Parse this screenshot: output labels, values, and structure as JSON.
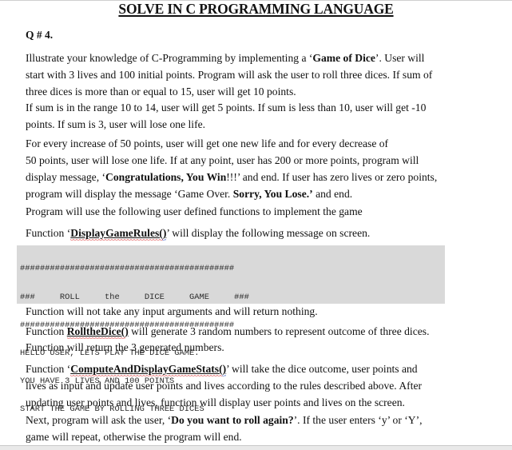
{
  "document": {
    "title": "SOLVE IN C PROGRAMMING LANGUAGE",
    "question_number": "Q # 4.",
    "intro": {
      "l1_a": "Illustrate your knowledge of C-Programming by implementing a ‘",
      "l1_b": "Game of Dice",
      "l1_c": "’. User will",
      "l2": "start with 3 lives and 100 initial points. Program will ask the user to roll three dices. If sum of",
      "l3": "three dices is more than or equal to 15, user will get 10 points."
    },
    "range_rule": {
      "l1": "If sum is in the range 10 to 14, user will get 5 points. If sum is less than 10, user will get -10",
      "l2": "points. If sum is 3, user will lose one life."
    },
    "lives_rule": {
      "l1": "For every increase of 50 points, user will get one new life and for every decrease of",
      "l2": "50 points, user will lose one life. If at any point, user has 200 or more points, program will",
      "l3_a": "display message, ‘",
      "l3_b": "Congratulations, You Win",
      "l3_c": "!!!’ and end. If user has zero lives or zero points,",
      "l4_a": "program will display the message ‘Game Over. ",
      "l4_b": "Sorry, You Lose.’",
      "l4_c": " and end."
    },
    "functions_intro": "Program will use the following user defined functions to implement the game",
    "display_rules": {
      "prefix": "Function ‘",
      "name": "DisplayGameRules()",
      "suffix": "’ will display the following message on screen."
    },
    "code_block": [
      "###########################################",
      "###     ROLL     the     DICE     GAME     ###",
      "###########################################",
      "HELLO USER, LETS PLAY THE DICE GAME.",
      "YOU HAVE 3 LIVES AND 100 POINTS",
      "START THE GAME BY ROLLING THREE DICES"
    ],
    "display_rules_note": "Function will not take any input arguments and will return nothing.",
    "roll_dice": {
      "prefix": "Function ",
      "name": "RolltheDice()",
      "suffix": " will generate 3 random numbers to represent outcome of three dices.",
      "l2": "Function will return the 3 generated numbers."
    },
    "compute_stats": {
      "prefix": "Function ‘",
      "name": "ComputeAndDisplayGameStats()",
      "suffix": "’ will take the dice outcome, user points  and",
      "l2": "lives as input and update user points and lives according to the rules described above. After",
      "l3": "updating user points and lives, function will display user points and lives on the screen."
    },
    "repeat_rule": {
      "l1_a": "Next, program will ask the user, ‘",
      "l1_b": "Do you want to roll again?",
      "l1_c": "’. If the user enters ‘y’ or ‘Y’,",
      "l2": "game will repeat, otherwise the program will end."
    }
  },
  "colors": {
    "text": "#111111",
    "code_background": "#d9d9d9",
    "spellcheck_red": "#dd3333",
    "grammar_blue": "#3a5fcd"
  }
}
